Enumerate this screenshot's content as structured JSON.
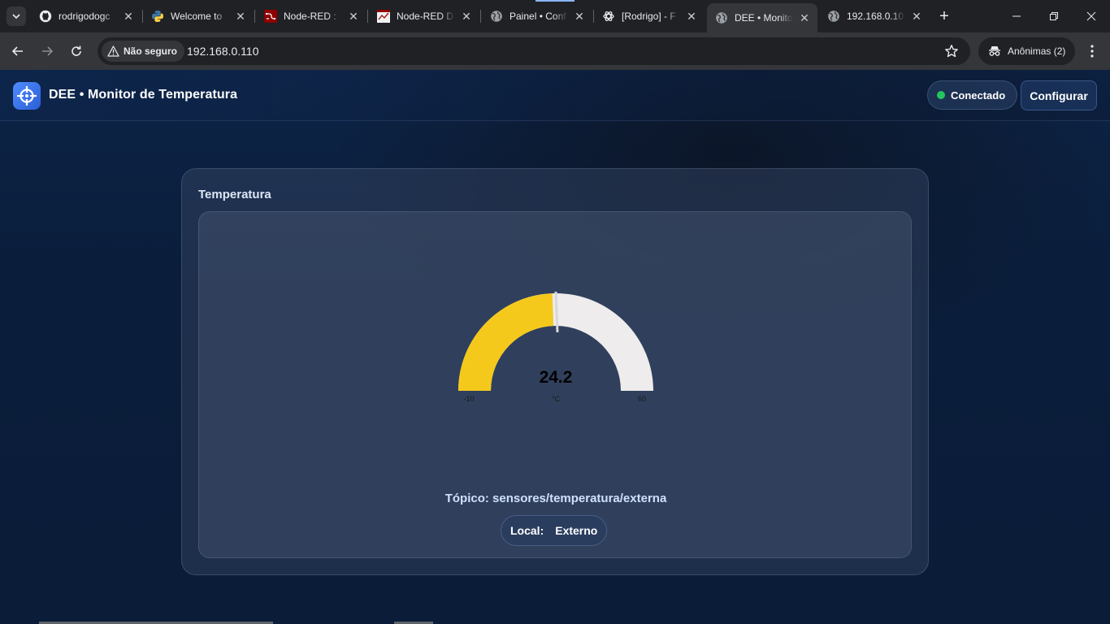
{
  "browser": {
    "tabs": [
      {
        "title": "rodrigodogc",
        "icon": "github-icon"
      },
      {
        "title": "Welcome to",
        "icon": "python-icon"
      },
      {
        "title": "Node-RED : ",
        "icon": "node-red-icon"
      },
      {
        "title": "Node-RED D",
        "icon": "node-red-dashboard-icon"
      },
      {
        "title": "Painel • Conf",
        "icon": "globe-icon"
      },
      {
        "title": "[Rodrigo] - F",
        "icon": "openai-icon"
      },
      {
        "title": "DEE • Monito",
        "icon": "globe-icon",
        "active": true
      },
      {
        "title": "192.168.0.10",
        "icon": "globe-icon"
      }
    ],
    "security_chip": "Não seguro",
    "url": "192.168.0.110",
    "incognito_label": "Anônimas (2)"
  },
  "app": {
    "title": "DEE • Monitor de Temperatura",
    "status": "Conectado",
    "status_color": "#22c55e",
    "configure_label": "Configurar"
  },
  "card": {
    "title": "Temperatura",
    "gauge": {
      "value": "24.2",
      "unit": "°C",
      "min": "-10",
      "max": "60",
      "fill_color": "#f5c91c",
      "track_color": "#eeecec"
    },
    "topic": "Tópico: sensores/temperatura/externa",
    "local_label": "Local:",
    "local_value": "Externo"
  }
}
